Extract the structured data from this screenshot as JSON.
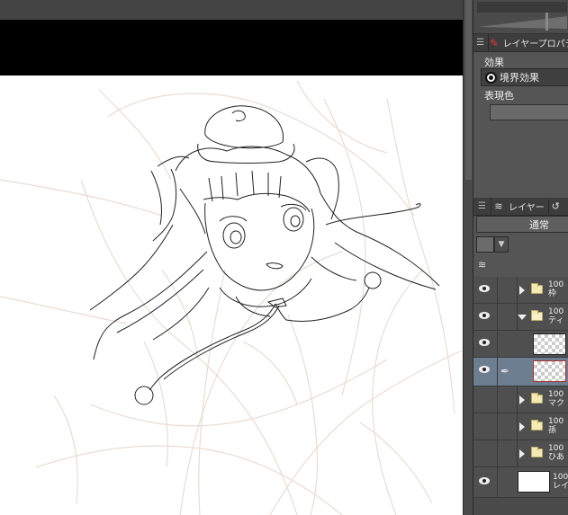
{
  "canvas": {
    "sketch_color": "#e8d8cc",
    "lineart_color": "#222222"
  },
  "property_panel": {
    "tab_label": "レイヤープロパティ",
    "effect_heading": "効果",
    "border_effect_label": "境界効果",
    "display_color_heading": "表現色"
  },
  "layer_panel": {
    "tab_label": "レイヤー",
    "blend_mode": "通常",
    "layers": [
      {
        "opacity": "100",
        "name": "枠",
        "type": "folder",
        "expanded": false,
        "visible": true
      },
      {
        "opacity": "100",
        "name": "ティ",
        "type": "folder",
        "expanded": true,
        "visible": true
      },
      {
        "opacity": "",
        "name": "",
        "type": "raster",
        "visible": true
      },
      {
        "opacity": "",
        "name": "",
        "type": "raster",
        "visible": true,
        "selected": true
      },
      {
        "opacity": "100",
        "name": "マク",
        "type": "folder",
        "expanded": false,
        "visible": false
      },
      {
        "opacity": "100",
        "name": "孫",
        "type": "folder",
        "expanded": false,
        "visible": false
      },
      {
        "opacity": "100",
        "name": "ひあ",
        "type": "folder",
        "expanded": false,
        "visible": false
      },
      {
        "opacity": "100",
        "name": "レイ",
        "type": "paper",
        "visible": true
      }
    ]
  }
}
